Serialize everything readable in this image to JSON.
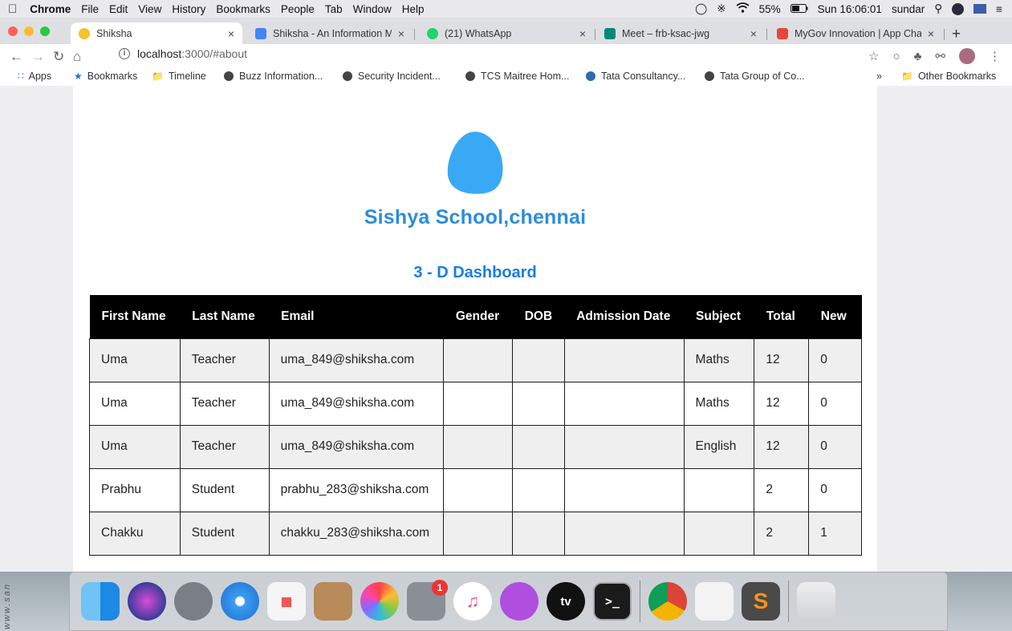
{
  "menubar": {
    "app_name": "Chrome",
    "items": [
      "File",
      "Edit",
      "View",
      "History",
      "Bookmarks",
      "People",
      "Tab",
      "Window",
      "Help"
    ],
    "battery": "55%",
    "clock": "Sun 16:06:01",
    "user": "sundar"
  },
  "tabs": [
    {
      "title": "Shiksha",
      "active": true
    },
    {
      "title": "Shiksha - An Information Ma",
      "active": false
    },
    {
      "title": "(21) WhatsApp",
      "active": false
    },
    {
      "title": "Meet – frb-ksac-jwg",
      "active": false
    },
    {
      "title": "MyGov Innovation | App Cha",
      "active": false
    }
  ],
  "address": {
    "host": "localhost",
    "path": ":3000/#about"
  },
  "bookmarks": {
    "apps_label": "Apps",
    "items": [
      "Bookmarks",
      "Timeline",
      "Buzz Information...",
      "Security Incident...",
      "TCS Maitree Hom...",
      "Tata Consultancy...",
      "Tata Group of Co..."
    ],
    "overflow": "»",
    "other": "Other Bookmarks"
  },
  "page": {
    "school_name": "Sishya School,chennai",
    "subtitle": "3 - D Dashboard",
    "logo_color": "#3aa9f5",
    "accent": "#1a7ee0"
  },
  "table": {
    "columns": [
      "First Name",
      "Last Name",
      "Email",
      "Gender",
      "DOB",
      "Admission Date",
      "Subject",
      "Total",
      "New"
    ],
    "rows": [
      [
        "Uma",
        "Teacher",
        "uma_849@shiksha.com",
        "",
        "",
        "",
        "Maths",
        "12",
        "0"
      ],
      [
        "Uma",
        "Teacher",
        "uma_849@shiksha.com",
        "",
        "",
        "",
        "Maths",
        "12",
        "0"
      ],
      [
        "Uma",
        "Teacher",
        "uma_849@shiksha.com",
        "",
        "",
        "",
        "English",
        "12",
        "0"
      ],
      [
        "Prabhu",
        "Student",
        "prabhu_283@shiksha.com",
        "",
        "",
        "",
        "",
        "2",
        "0"
      ],
      [
        "Chakku",
        "Student",
        "chakku_283@shiksha.com",
        "",
        "",
        "",
        "",
        "2",
        "1"
      ]
    ]
  },
  "dock": {
    "apps": [
      "finder",
      "siri",
      "launchpad",
      "safari",
      "app-grid",
      "contacts",
      "photos",
      "system-preferences",
      "music",
      "podcasts",
      "apple-tv",
      "terminal",
      "chrome",
      "textedit",
      "sublime-text",
      "trash"
    ],
    "system_preferences_badge": "1",
    "tv_label": "tv"
  }
}
